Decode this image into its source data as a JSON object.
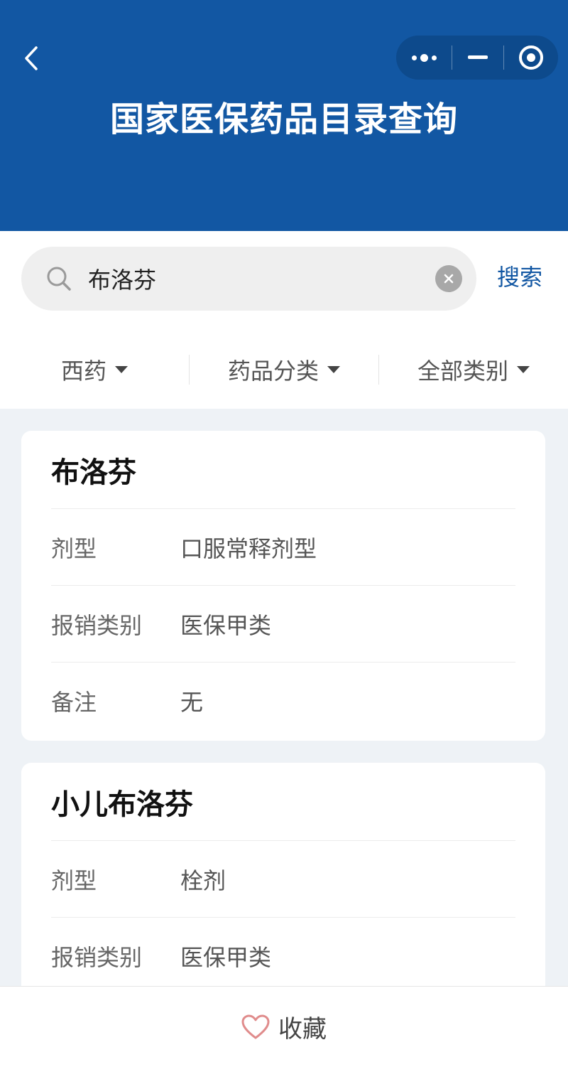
{
  "header": {
    "title": "国家医保药品目录查询",
    "color": "#1257a3"
  },
  "search": {
    "value": "布洛芬",
    "placeholder": "",
    "button_label": "搜索"
  },
  "filters": [
    {
      "label": "西药"
    },
    {
      "label": "药品分类"
    },
    {
      "label": "全部类别"
    }
  ],
  "results": [
    {
      "name": "布洛芬",
      "fields": [
        {
          "label": "剂型",
          "value": "口服常释剂型"
        },
        {
          "label": "报销类别",
          "value": "医保甲类"
        },
        {
          "label": "备注",
          "value": "无"
        }
      ]
    },
    {
      "name": "小儿布洛芬",
      "fields": [
        {
          "label": "剂型",
          "value": "栓剂"
        },
        {
          "label": "报销类别",
          "value": "医保甲类"
        }
      ]
    }
  ],
  "bottom_bar": {
    "favorite_label": "收藏",
    "favorite_icon": "heart-icon"
  }
}
